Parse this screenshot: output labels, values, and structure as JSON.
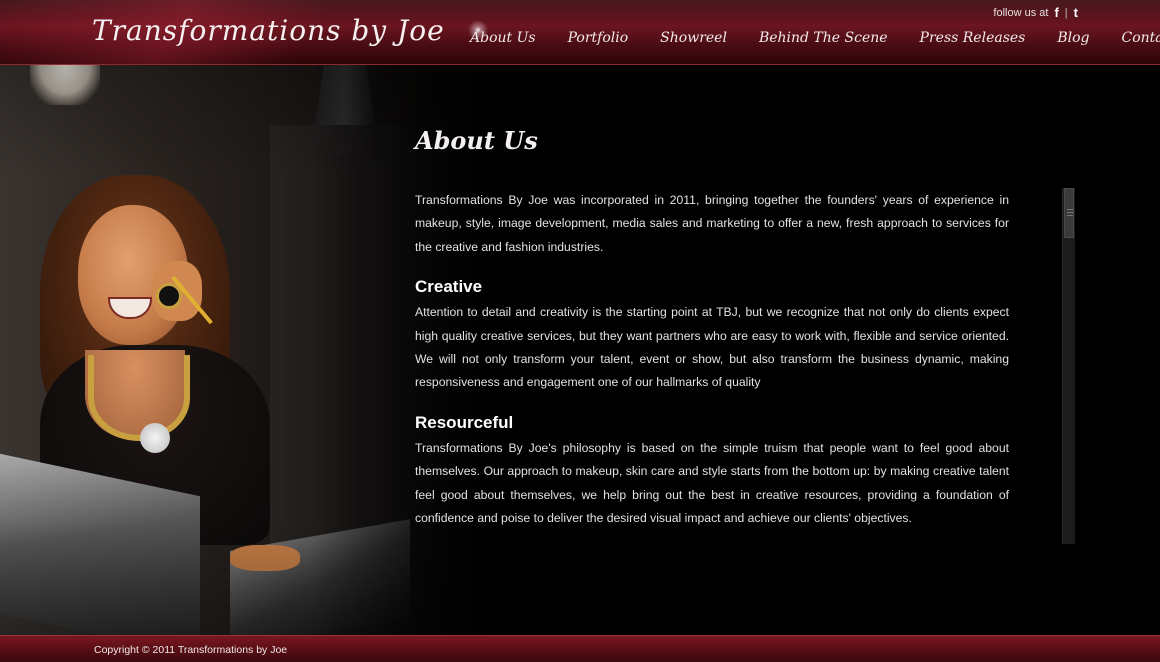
{
  "header": {
    "logo": "Transformations by Joe",
    "follow_label": "follow us at",
    "social": {
      "facebook": "f",
      "separator": "|",
      "twitter": "t"
    }
  },
  "nav": {
    "items": [
      {
        "label": "About Us"
      },
      {
        "label": "Portfolio"
      },
      {
        "label": "Showreel"
      },
      {
        "label": "Behind The Scene"
      },
      {
        "label": "Press Releases"
      },
      {
        "label": "Blog"
      },
      {
        "label": "Contact"
      }
    ]
  },
  "main": {
    "title": "About Us",
    "intro": "Transformations By Joe was incorporated in 2011, bringing together the founders' years of experience in makeup, style, image development, media sales and marketing to offer a new, fresh approach to services for the creative and fashion industries.",
    "sections": [
      {
        "heading": "Creative",
        "body": "Attention to detail and creativity is the starting point at TBJ, but we recognize that not only do clients expect high quality creative services, but they want partners who are easy to work with, flexible and service oriented. We will not only transform your talent, event or show, but also transform the business dynamic, making responsiveness and engagement one of our hallmarks of quality"
      },
      {
        "heading": "Resourceful",
        "body": "Transformations By Joe's philosophy is based on the simple truism that people want to feel good about themselves. Our approach to makeup, skin care and style starts from the bottom up: by making creative talent feel good about themselves, we help bring out the best in creative resources, providing a foundation of confidence and poise to deliver the desired visual impact and achieve our clients' objectives."
      }
    ]
  },
  "footer": {
    "copyright": "Copyright © 2011 Transformations by Joe"
  },
  "colors": {
    "header_red": "#6b1520",
    "footer_red": "#5a0e16",
    "background": "#000000"
  }
}
